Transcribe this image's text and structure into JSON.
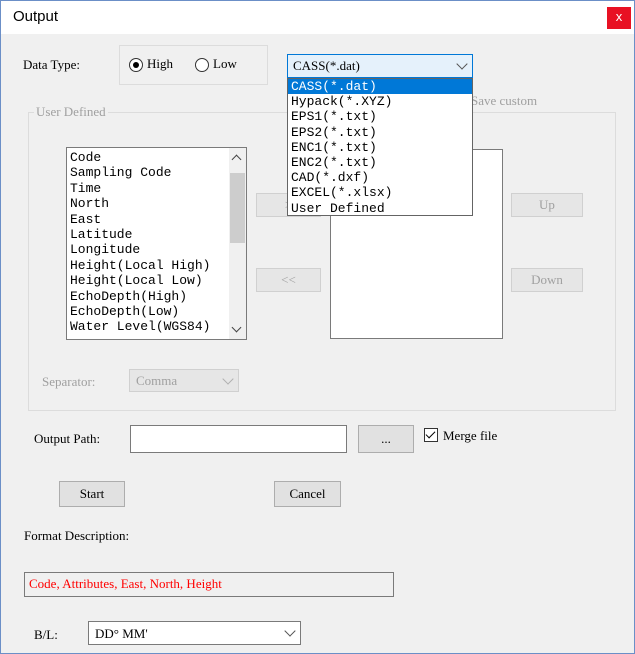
{
  "window": {
    "title": "Output",
    "close_glyph": "x"
  },
  "data_type": {
    "label": "Data Type:",
    "options": [
      {
        "label": "High",
        "selected": true
      },
      {
        "label": "Low",
        "selected": false
      }
    ],
    "format_selected": "CASS(*.dat)",
    "format_options": [
      "CASS(*.dat)",
      "Hypack(*.XYZ)",
      "EPS1(*.txt)",
      "EPS2(*.txt)",
      "ENC1(*.txt)",
      "ENC2(*.txt)",
      "CAD(*.dxf)",
      "EXCEL(*.xlsx)",
      "User Defined"
    ],
    "highlighted_index": 0
  },
  "user_defined": {
    "group_label": "User Defined",
    "save_custom_label": "Save custom",
    "fields": [
      "Code",
      "Sampling Code",
      "Time",
      "North",
      "East",
      "Latitude",
      "Longitude",
      "Height(Local High)",
      "Height(Local Low)",
      "EchoDepth(High)",
      "EchoDepth(Low)",
      "Water Level(WGS84)"
    ],
    "add_label": ">",
    "remove_label": "<<",
    "up_label": "Up",
    "down_label": "Down",
    "separator_label": "Separator:",
    "separator_value": "Comma"
  },
  "output": {
    "path_label": "Output Path:",
    "path_value": "",
    "browse_label": "...",
    "merge_label": "Merge file",
    "merge_checked": true
  },
  "actions": {
    "start_label": "Start",
    "cancel_label": "Cancel"
  },
  "format_description": {
    "label": "Format Description:",
    "value": "Code, Attributes, East, North, Height",
    "color": "#ff0000"
  },
  "bl": {
    "label": "B/L:",
    "value": "DD° MM'"
  }
}
